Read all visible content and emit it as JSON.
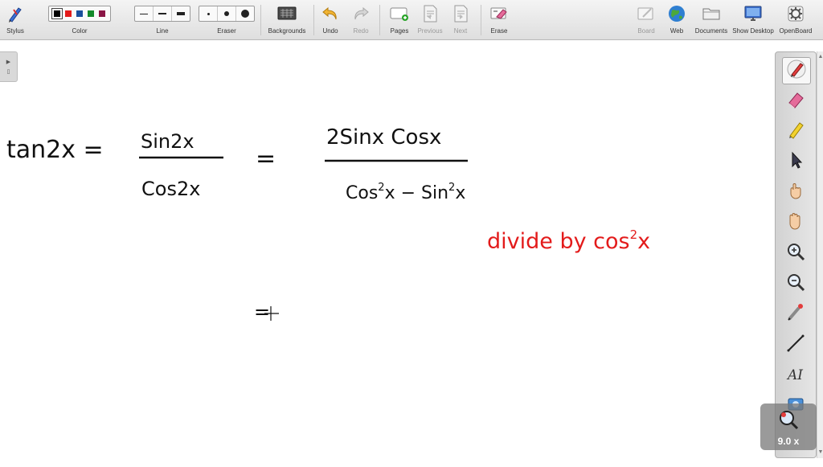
{
  "toolbar": {
    "stylus": "Stylus",
    "color": "Color",
    "line": "Line",
    "eraser": "Eraser",
    "backgrounds": "Backgrounds",
    "undo": "Undo",
    "redo": "Redo",
    "pages": "Pages",
    "previous": "Previous",
    "next": "Next",
    "erase": "Erase",
    "board": "Board",
    "web": "Web",
    "documents": "Documents",
    "show_desktop": "Show Desktop",
    "openboard": "OpenBoard"
  },
  "colors": {
    "swatches": [
      "#000000",
      "#e31b1b",
      "#1a4f9c",
      "#158a2b",
      "#8a1545"
    ],
    "selected_index": 0,
    "ink": "#111111",
    "ink_red": "#e31b1b"
  },
  "handwriting": {
    "line1_lhs": "tan2x =",
    "line1_num1": "Sin2x",
    "line1_den1": "Cos2x",
    "line1_eq": "=",
    "line1_num2": "2Sinx Cosx",
    "line1_den2_a": "Cos",
    "line1_den2_b": "2",
    "line1_den2_c": "x − Sin",
    "line1_den2_d": "2",
    "line1_den2_e": "x",
    "note_a": "divide by cos",
    "note_b": "2",
    "note_c": "x",
    "line2_eq": "="
  },
  "tools": [
    "pen-tool-icon",
    "eraser-tool-icon",
    "marker-tool-icon",
    "selector-tool-icon",
    "interactor-tool-icon",
    "hand-tool-icon",
    "zoom-in-tool-icon",
    "zoom-out-tool-icon",
    "laser-pointer-tool-icon",
    "line-tool-icon",
    "text-tool-icon",
    "capture-tool-icon"
  ],
  "zoom": {
    "label": "9.0 x"
  }
}
